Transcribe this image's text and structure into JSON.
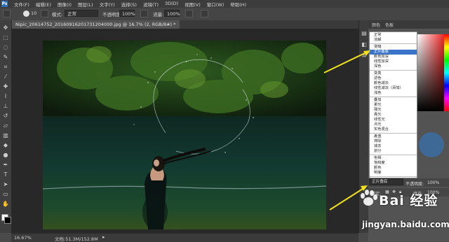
{
  "menubar": {
    "logo": "Ps",
    "items": [
      "文件(F)",
      "编辑(E)",
      "图像(I)",
      "图层(L)",
      "文字(Y)",
      "选择(S)",
      "滤镜(T)",
      "3D(D)",
      "视图(V)",
      "窗口(W)",
      "帮助(H)"
    ]
  },
  "options": {
    "brush_size": "10",
    "mode_label": "模式:",
    "mode_value": "正常",
    "opacity_label": "不透明度:",
    "opacity_value": "100%",
    "flow_label": "流量:",
    "flow_value": "100%"
  },
  "document": {
    "tab_title": "Nipic_20614752_20160916201731204000.jpg @ 16.7% (2, RGB/8#) *",
    "zoom": "16.67%",
    "doc_size": "文档:51.3M/152.8M"
  },
  "panels": {
    "tab_color": "颜色",
    "tab_swatches": "色板",
    "opacity_label": "不透明度:",
    "opacity_value": "100%",
    "lock_label": "锁定:",
    "fill_label": "填充:",
    "fill_value": "100%"
  },
  "blend_modes": {
    "current": "正片叠底",
    "selected": "正片叠底",
    "groups": [
      [
        "正常",
        "溶解"
      ],
      [
        "变暗",
        "正片叠底",
        "颜色加深",
        "线性加深",
        "深色"
      ],
      [
        "变亮",
        "滤色",
        "颜色减淡",
        "线性减淡（添加）",
        "浅色"
      ],
      [
        "叠加",
        "柔光",
        "强光",
        "亮光",
        "线性光",
        "点光",
        "实色混合"
      ],
      [
        "差值",
        "排除",
        "减去",
        "划分"
      ],
      [
        "色相",
        "饱和度",
        "颜色",
        "明度"
      ]
    ]
  },
  "watermark": {
    "text": "Bai 经验",
    "url": "jingyan.baidu.com"
  },
  "colors": {
    "accent": "#3a74c9",
    "arrow": "#f2e21a"
  }
}
